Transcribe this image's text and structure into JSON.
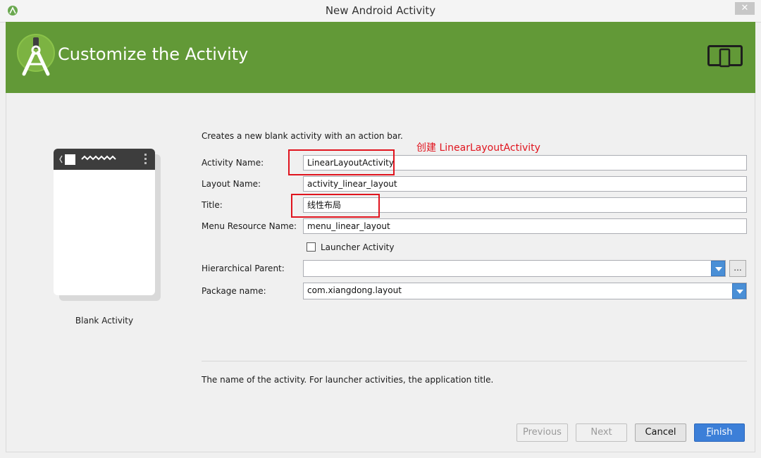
{
  "window": {
    "title": "New Android Activity",
    "close_label": "✕"
  },
  "header": {
    "title": "Customize the Activity"
  },
  "preview": {
    "label": "Blank Activity"
  },
  "form": {
    "description": "Creates a new blank activity with an action bar.",
    "activity_name": {
      "label": "Activity Name:",
      "value": "LinearLayoutActivity"
    },
    "layout_name": {
      "label": "Layout Name:",
      "value": "activity_linear_layout"
    },
    "title": {
      "label": "Title:",
      "value": "线性布局"
    },
    "menu_resource": {
      "label": "Menu Resource Name:",
      "value": "menu_linear_layout"
    },
    "launcher": {
      "label": "Launcher Activity",
      "checked": false
    },
    "hierarchical_parent": {
      "label": "Hierarchical Parent:",
      "value": "",
      "browse_label": "..."
    },
    "package_name": {
      "label": "Package name:",
      "value": "com.xiangdong.layout"
    }
  },
  "annotation": {
    "text": "创建 LinearLayoutActivity",
    "color": "#e0141e"
  },
  "help_text": "The name of the activity. For launcher activities, the application title.",
  "buttons": {
    "previous": "Previous",
    "next": "Next",
    "cancel": "Cancel",
    "finish_first": "F",
    "finish_rest": "inish"
  },
  "colors": {
    "header": "#629937",
    "primary_button": "#3c7fd8"
  },
  "icons": [
    "android-studio-icon",
    "android-studio-logo",
    "phone-tablet-icon",
    "phone-back-icon",
    "phone-overflow-icon"
  ]
}
